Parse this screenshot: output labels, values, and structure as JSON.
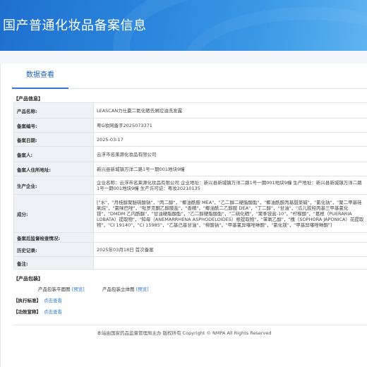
{
  "header": {
    "title": "国产普通化妆品备案信息"
  },
  "tabs": [
    {
      "label": "数据查看"
    }
  ],
  "product_info": {
    "section_title": "【产品信息】",
    "rows": [
      {
        "label": "产品名称:",
        "value": "LEASCAN力仕赢二氮化硒去屑控油洗发露"
      },
      {
        "label": "备案编号:",
        "value": "粤G妆网备字2025073371"
      },
      {
        "label": "备案日期:",
        "value": "2025-03-17"
      },
      {
        "label": "备案人:",
        "value": "云浮市名莱源化妆品有限公司"
      },
      {
        "label": "备案人住所地址:",
        "value": "新兴县新城镇万洋二路1号一期001地块9幢"
      },
      {
        "label": "生产企业:",
        "value": "企业名称：云浮市名莱源化妆品有限公司 企业地址：新兴县新城镇万洋二路1号一期001地块9幢 生产地址：新兴县新城镇万洋二路1号一期001地块9幢 生产许可证：粤妆20210135"
      },
      {
        "label": "成分:",
        "value": "[\"水\"，\"月桂醇聚醚硫酸钠\"，\"丙二醇\"，\"椰油酰胺 MEA\"，\"乙二醇二硬脂酸酯\"，\"椰油酰胺丙基甜菜碱\"，\"氯化钠\"，\"聚二甲基硅氧烷\"，\"氯咪巴唑\"，\"吡罗克酮乙醇胺盐\"，\"香精\"，\"椰油酰二乙醇胺 DEA\"，\"丁二醇\"，\"甘油\"，\"瓜儿胶羟丙基三甲基氯化铵\"，\"DMDM 乙内酰脲\"，\"甘油硬脂酸酯\"，\"乙二醇硬脂酸酯\"，\"二硫化硒\"，\"聚季铵盐-10\"，\"柠檬酸\"，\"葛根（PUERARIA LOBATA）提取物\"，\"知母（ANEMARRHENA ASPHODELOIDES）根提取物\"，\"苯氧乙醇\"，\"槐（SOPHORA JAPONICA）花提取物\"，\"CI 19140\"，\"CI 15985\"，\"乙基己基甘油\"，\"柳酸钠\"，\"甲基氯异噻唑啉酮\"，\"氯化镁\"，\"甲基异噻唑啉酮\"]"
      },
      {
        "label": "备案后监督检查情况:",
        "value": ""
      },
      {
        "label": "历史记录:",
        "value": "2025年03月18日 首次备案"
      },
      {
        "label": "备注:",
        "value": ""
      }
    ]
  },
  "packaging": {
    "section_title": "【产品包装】",
    "plan_label": "产品包装平面图",
    "plan_link": "[预览]",
    "stereo_label": "产品包装立体图",
    "stereo_link": "[预览]"
  },
  "standard": {
    "label": "【执行标准】",
    "link": "点击查看"
  },
  "efficacy": {
    "label": "【功效宣称】",
    "link": "点击查看"
  },
  "footer": {
    "text": "本站由国家药品监督管理局主办 版权所有 Copyright © NMPA All Rights Reserved"
  }
}
